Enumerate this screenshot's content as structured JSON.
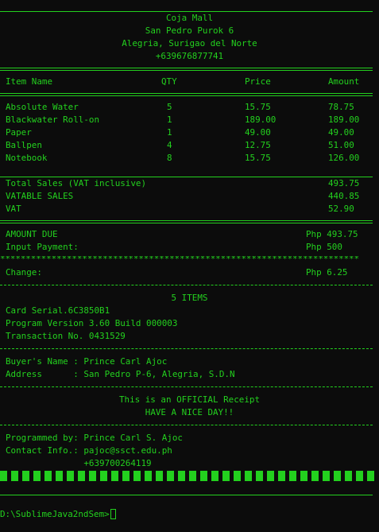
{
  "store": {
    "name": "Coja Mall",
    "street": "San Pedro Purok 6",
    "city": "Alegria, Surigao del Norte",
    "phone": "+639676877741"
  },
  "table": {
    "headers": [
      "Item Name",
      "QTY",
      "Price",
      "Amount"
    ],
    "rows": [
      [
        "Absolute Water",
        "5",
        "15.75",
        "78.75"
      ],
      [
        "Blackwater Roll-on",
        "1",
        "189.00",
        "189.00"
      ],
      [
        "Paper",
        "1",
        "49.00",
        "49.00"
      ],
      [
        "Ballpen",
        "4",
        "12.75",
        "51.00"
      ],
      [
        "Notebook",
        "8",
        "15.75",
        "126.00"
      ]
    ]
  },
  "totals": {
    "total_label": "Total Sales (VAT inclusive)",
    "total_value": "493.75",
    "vatable_label": "VATABLE SALES",
    "vatable_value": "440.85",
    "vat_label": "VAT",
    "vat_value": "52.90"
  },
  "payment": {
    "due_label": "AMOUNT DUE",
    "due_value": "Php 493.75",
    "input_label": "Input Payment:",
    "input_value": "Php 500",
    "stars": "**********************************************************************",
    "change_label": "Change:",
    "change_value": "Php 6.25"
  },
  "info": {
    "items_count": "5 ITEMS",
    "card_serial": "Card Serial.6C3850B1",
    "program_version": "Program Version 3.60 Build 000003",
    "transaction": "Transaction No. 0431529"
  },
  "buyer": {
    "name_line": "Buyer's Name : Prince Carl Ajoc",
    "address_line": "Address      : San Pedro P-6, Alegria, S.D.N"
  },
  "footer": {
    "official": "This is an OFFICIAL Receipt",
    "greeting": "HAVE A NICE DAY!!",
    "programmed_by": "Programmed by: Prince Carl S. Ajoc",
    "contact": "Contact Info.: pajoc@ssct.edu.ph",
    "contact_phone": "               +639700264119"
  },
  "prompt": {
    "path": "D:\\SublimeJava2ndSem>"
  },
  "colors": {
    "background": "#0c0c0c",
    "text": "#23d01e"
  }
}
